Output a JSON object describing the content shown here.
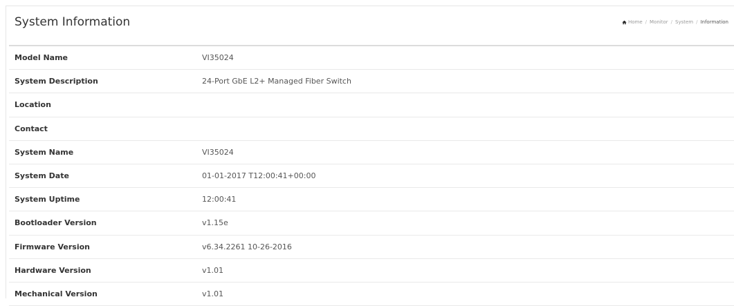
{
  "header": {
    "title": "System Information",
    "breadcrumb": [
      "Home",
      "Monitor",
      "System",
      "Information"
    ]
  },
  "rows": [
    {
      "label": "Model Name",
      "value": "VI35024"
    },
    {
      "label": "System Description",
      "value": "24-Port GbE L2+ Managed Fiber Switch"
    },
    {
      "label": "Location",
      "value": ""
    },
    {
      "label": "Contact",
      "value": ""
    },
    {
      "label": "System Name",
      "value": "VI35024"
    },
    {
      "label": "System Date",
      "value": "01-01-2017 T12:00:41+00:00"
    },
    {
      "label": "System Uptime",
      "value": "12:00:41"
    },
    {
      "label": "Bootloader Version",
      "value": "v1.15e"
    },
    {
      "label": "Firmware Version",
      "value": "v6.34.2261 10-26-2016"
    },
    {
      "label": "Hardware Version",
      "value": "v1.01"
    },
    {
      "label": "Mechanical Version",
      "value": "v1.01"
    }
  ]
}
